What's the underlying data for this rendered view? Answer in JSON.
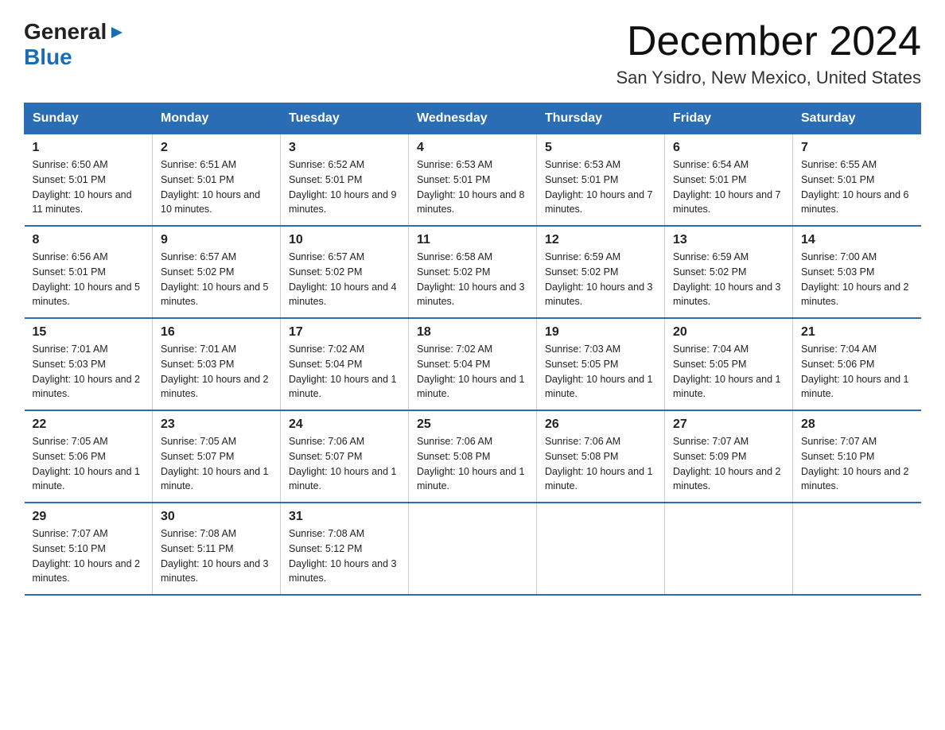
{
  "logo": {
    "general": "General",
    "blue": "Blue",
    "arrow": "▶"
  },
  "header": {
    "month": "December 2024",
    "location": "San Ysidro, New Mexico, United States"
  },
  "days_of_week": [
    "Sunday",
    "Monday",
    "Tuesday",
    "Wednesday",
    "Thursday",
    "Friday",
    "Saturday"
  ],
  "weeks": [
    [
      {
        "num": "1",
        "sunrise": "Sunrise: 6:50 AM",
        "sunset": "Sunset: 5:01 PM",
        "daylight": "Daylight: 10 hours and 11 minutes."
      },
      {
        "num": "2",
        "sunrise": "Sunrise: 6:51 AM",
        "sunset": "Sunset: 5:01 PM",
        "daylight": "Daylight: 10 hours and 10 minutes."
      },
      {
        "num": "3",
        "sunrise": "Sunrise: 6:52 AM",
        "sunset": "Sunset: 5:01 PM",
        "daylight": "Daylight: 10 hours and 9 minutes."
      },
      {
        "num": "4",
        "sunrise": "Sunrise: 6:53 AM",
        "sunset": "Sunset: 5:01 PM",
        "daylight": "Daylight: 10 hours and 8 minutes."
      },
      {
        "num": "5",
        "sunrise": "Sunrise: 6:53 AM",
        "sunset": "Sunset: 5:01 PM",
        "daylight": "Daylight: 10 hours and 7 minutes."
      },
      {
        "num": "6",
        "sunrise": "Sunrise: 6:54 AM",
        "sunset": "Sunset: 5:01 PM",
        "daylight": "Daylight: 10 hours and 7 minutes."
      },
      {
        "num": "7",
        "sunrise": "Sunrise: 6:55 AM",
        "sunset": "Sunset: 5:01 PM",
        "daylight": "Daylight: 10 hours and 6 minutes."
      }
    ],
    [
      {
        "num": "8",
        "sunrise": "Sunrise: 6:56 AM",
        "sunset": "Sunset: 5:01 PM",
        "daylight": "Daylight: 10 hours and 5 minutes."
      },
      {
        "num": "9",
        "sunrise": "Sunrise: 6:57 AM",
        "sunset": "Sunset: 5:02 PM",
        "daylight": "Daylight: 10 hours and 5 minutes."
      },
      {
        "num": "10",
        "sunrise": "Sunrise: 6:57 AM",
        "sunset": "Sunset: 5:02 PM",
        "daylight": "Daylight: 10 hours and 4 minutes."
      },
      {
        "num": "11",
        "sunrise": "Sunrise: 6:58 AM",
        "sunset": "Sunset: 5:02 PM",
        "daylight": "Daylight: 10 hours and 3 minutes."
      },
      {
        "num": "12",
        "sunrise": "Sunrise: 6:59 AM",
        "sunset": "Sunset: 5:02 PM",
        "daylight": "Daylight: 10 hours and 3 minutes."
      },
      {
        "num": "13",
        "sunrise": "Sunrise: 6:59 AM",
        "sunset": "Sunset: 5:02 PM",
        "daylight": "Daylight: 10 hours and 3 minutes."
      },
      {
        "num": "14",
        "sunrise": "Sunrise: 7:00 AM",
        "sunset": "Sunset: 5:03 PM",
        "daylight": "Daylight: 10 hours and 2 minutes."
      }
    ],
    [
      {
        "num": "15",
        "sunrise": "Sunrise: 7:01 AM",
        "sunset": "Sunset: 5:03 PM",
        "daylight": "Daylight: 10 hours and 2 minutes."
      },
      {
        "num": "16",
        "sunrise": "Sunrise: 7:01 AM",
        "sunset": "Sunset: 5:03 PM",
        "daylight": "Daylight: 10 hours and 2 minutes."
      },
      {
        "num": "17",
        "sunrise": "Sunrise: 7:02 AM",
        "sunset": "Sunset: 5:04 PM",
        "daylight": "Daylight: 10 hours and 1 minute."
      },
      {
        "num": "18",
        "sunrise": "Sunrise: 7:02 AM",
        "sunset": "Sunset: 5:04 PM",
        "daylight": "Daylight: 10 hours and 1 minute."
      },
      {
        "num": "19",
        "sunrise": "Sunrise: 7:03 AM",
        "sunset": "Sunset: 5:05 PM",
        "daylight": "Daylight: 10 hours and 1 minute."
      },
      {
        "num": "20",
        "sunrise": "Sunrise: 7:04 AM",
        "sunset": "Sunset: 5:05 PM",
        "daylight": "Daylight: 10 hours and 1 minute."
      },
      {
        "num": "21",
        "sunrise": "Sunrise: 7:04 AM",
        "sunset": "Sunset: 5:06 PM",
        "daylight": "Daylight: 10 hours and 1 minute."
      }
    ],
    [
      {
        "num": "22",
        "sunrise": "Sunrise: 7:05 AM",
        "sunset": "Sunset: 5:06 PM",
        "daylight": "Daylight: 10 hours and 1 minute."
      },
      {
        "num": "23",
        "sunrise": "Sunrise: 7:05 AM",
        "sunset": "Sunset: 5:07 PM",
        "daylight": "Daylight: 10 hours and 1 minute."
      },
      {
        "num": "24",
        "sunrise": "Sunrise: 7:06 AM",
        "sunset": "Sunset: 5:07 PM",
        "daylight": "Daylight: 10 hours and 1 minute."
      },
      {
        "num": "25",
        "sunrise": "Sunrise: 7:06 AM",
        "sunset": "Sunset: 5:08 PM",
        "daylight": "Daylight: 10 hours and 1 minute."
      },
      {
        "num": "26",
        "sunrise": "Sunrise: 7:06 AM",
        "sunset": "Sunset: 5:08 PM",
        "daylight": "Daylight: 10 hours and 1 minute."
      },
      {
        "num": "27",
        "sunrise": "Sunrise: 7:07 AM",
        "sunset": "Sunset: 5:09 PM",
        "daylight": "Daylight: 10 hours and 2 minutes."
      },
      {
        "num": "28",
        "sunrise": "Sunrise: 7:07 AM",
        "sunset": "Sunset: 5:10 PM",
        "daylight": "Daylight: 10 hours and 2 minutes."
      }
    ],
    [
      {
        "num": "29",
        "sunrise": "Sunrise: 7:07 AM",
        "sunset": "Sunset: 5:10 PM",
        "daylight": "Daylight: 10 hours and 2 minutes."
      },
      {
        "num": "30",
        "sunrise": "Sunrise: 7:08 AM",
        "sunset": "Sunset: 5:11 PM",
        "daylight": "Daylight: 10 hours and 3 minutes."
      },
      {
        "num": "31",
        "sunrise": "Sunrise: 7:08 AM",
        "sunset": "Sunset: 5:12 PM",
        "daylight": "Daylight: 10 hours and 3 minutes."
      },
      {
        "num": "",
        "sunrise": "",
        "sunset": "",
        "daylight": ""
      },
      {
        "num": "",
        "sunrise": "",
        "sunset": "",
        "daylight": ""
      },
      {
        "num": "",
        "sunrise": "",
        "sunset": "",
        "daylight": ""
      },
      {
        "num": "",
        "sunrise": "",
        "sunset": "",
        "daylight": ""
      }
    ]
  ]
}
